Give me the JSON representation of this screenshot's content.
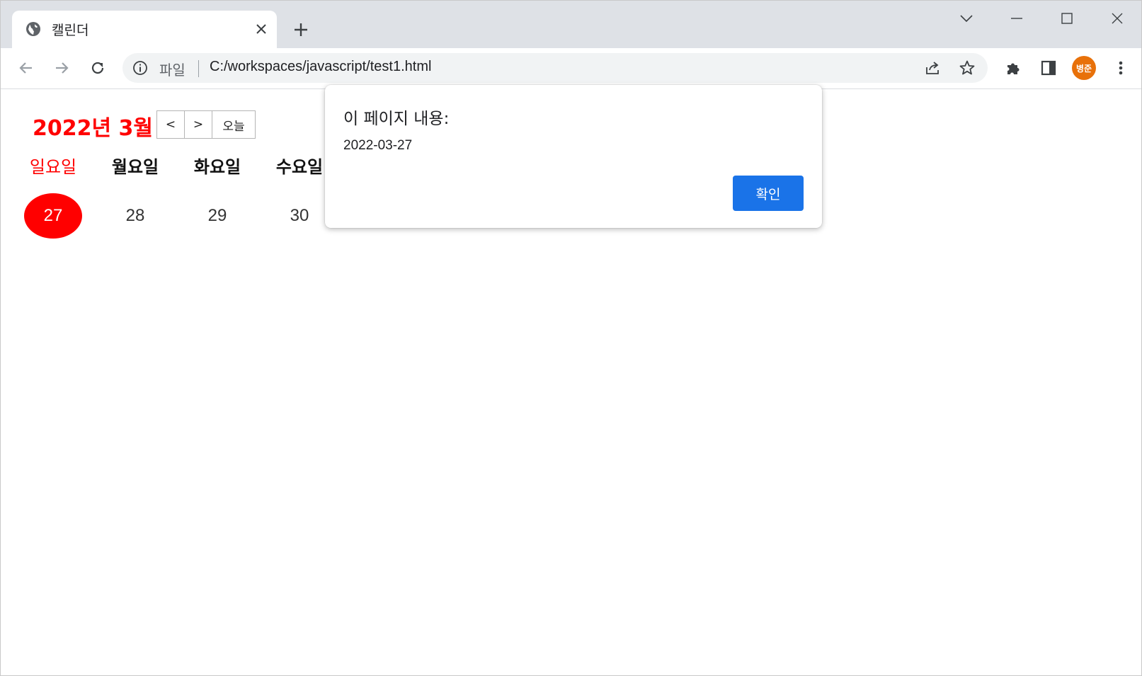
{
  "browser": {
    "tab": {
      "title": "캘린더",
      "favicon": "globe-icon"
    },
    "new_tab_icon": "plus-icon",
    "window_controls": [
      "chevron-down-icon",
      "minimize-icon",
      "maximize-icon",
      "close-icon"
    ],
    "omnibox": {
      "scheme_label": "파일",
      "url": "C:/workspaces/javascript/test1.html"
    },
    "profile": {
      "initials": "병준",
      "color": "#e8710a"
    }
  },
  "calendar": {
    "title": "2022년 3월",
    "nav": {
      "prev": "<",
      "next": ">",
      "today": "오늘"
    },
    "weekdays": [
      "일요일",
      "월요일",
      "화요일",
      "수요일"
    ],
    "days": [
      "27",
      "28",
      "29",
      "30"
    ],
    "today_color": "#ff0000"
  },
  "dialog": {
    "title": "이 페이지 내용:",
    "message": "2022-03-27",
    "ok_label": "확인",
    "ok_color": "#1a73e8"
  }
}
